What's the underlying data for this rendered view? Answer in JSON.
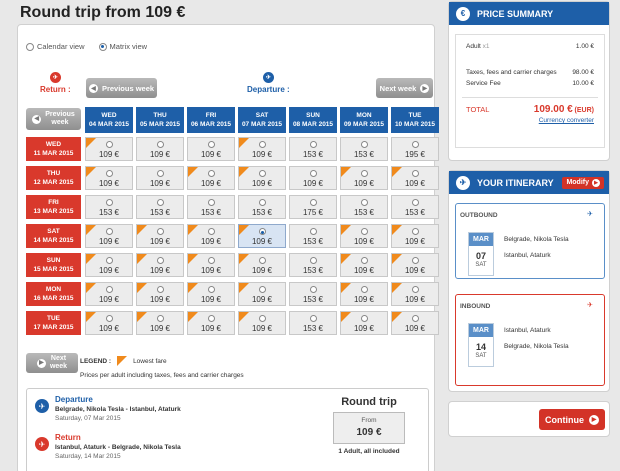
{
  "page_title": "Round trip from 109 €",
  "view_options": {
    "calendar": "Calendar view",
    "matrix": "Matrix view"
  },
  "return_label": "Return :",
  "departure_label": "Departure :",
  "prev_week": "Previous week",
  "next_week": "Next week",
  "prev_week_col": [
    "Previous",
    "week"
  ],
  "next_week_row": [
    "Next",
    "week"
  ],
  "columns": [
    {
      "day": "WED",
      "date": "04 MAR 2015"
    },
    {
      "day": "THU",
      "date": "05 MAR 2015"
    },
    {
      "day": "FRI",
      "date": "06 MAR 2015"
    },
    {
      "day": "SAT",
      "date": "07 MAR 2015"
    },
    {
      "day": "SUN",
      "date": "08 MAR 2015"
    },
    {
      "day": "MON",
      "date": "09 MAR 2015"
    },
    {
      "day": "TUE",
      "date": "10 MAR 2015"
    }
  ],
  "rows": [
    {
      "day": "WED",
      "date": "11 MAR 2015",
      "prices": [
        "109 €",
        "109 €",
        "109 €",
        "109 €",
        "153 €",
        "153 €",
        "195 €"
      ],
      "lowest": [
        true,
        false,
        false,
        true,
        false,
        false,
        false
      ]
    },
    {
      "day": "THU",
      "date": "12 MAR 2015",
      "prices": [
        "109 €",
        "109 €",
        "109 €",
        "109 €",
        "109 €",
        "109 €",
        "109 €"
      ],
      "lowest": [
        true,
        false,
        true,
        true,
        false,
        true,
        true
      ]
    },
    {
      "day": "FRI",
      "date": "13 MAR 2015",
      "prices": [
        "153 €",
        "153 €",
        "153 €",
        "153 €",
        "175 €",
        "153 €",
        "153 €"
      ],
      "lowest": [
        false,
        false,
        false,
        false,
        false,
        false,
        false
      ]
    },
    {
      "day": "SAT",
      "date": "14 MAR 2015",
      "prices": [
        "109 €",
        "109 €",
        "109 €",
        "109 €",
        "153 €",
        "109 €",
        "109 €"
      ],
      "lowest": [
        true,
        true,
        true,
        true,
        false,
        true,
        true
      ]
    },
    {
      "day": "SUN",
      "date": "15 MAR 2015",
      "prices": [
        "109 €",
        "109 €",
        "109 €",
        "109 €",
        "153 €",
        "109 €",
        "109 €"
      ],
      "lowest": [
        true,
        true,
        true,
        true,
        false,
        true,
        true
      ]
    },
    {
      "day": "MON",
      "date": "16 MAR 2015",
      "prices": [
        "109 €",
        "109 €",
        "109 €",
        "109 €",
        "153 €",
        "109 €",
        "109 €"
      ],
      "lowest": [
        true,
        true,
        true,
        true,
        false,
        true,
        true
      ]
    },
    {
      "day": "TUE",
      "date": "17 MAR 2015",
      "prices": [
        "109 €",
        "109 €",
        "109 €",
        "109 €",
        "153 €",
        "109 €",
        "109 €"
      ],
      "lowest": [
        true,
        true,
        true,
        true,
        false,
        true,
        true
      ]
    }
  ],
  "selected_cell": {
    "row": 3,
    "col": 3
  },
  "legend": {
    "title": "LEGEND :",
    "lowest": "Lowest fare",
    "note": "Prices per adult including taxes, fees and carrier charges"
  },
  "summary": {
    "departure": {
      "title": "Departure",
      "route": "Belgrade, Nikola Tesla - Istanbul, Ataturk",
      "date": "Saturday, 07 Mar 2015"
    },
    "return": {
      "title": "Return",
      "route": "Istanbul, Ataturk - Belgrade, Nikola Tesla",
      "date": "Saturday, 14 Mar 2015"
    },
    "round_trip": "Round trip",
    "from": "From",
    "price": "109 €",
    "note": "1 Adult, all included"
  },
  "price_summary": {
    "title": "PRICE SUMMARY",
    "adult_label": "Adult",
    "adult_count": "x1",
    "adult_value": "1.00 €",
    "taxes_label": "Taxes, fees and carrier charges",
    "taxes_value": "98.00 €",
    "fee_label": "Service Fee",
    "fee_value": "10.00 €",
    "total_label": "TOTAL",
    "total_value": "109.00 €",
    "total_currency": "(EUR)",
    "converter": "Currency converter"
  },
  "itinerary": {
    "title": "YOUR ITINERARY",
    "modify": "Modify",
    "outbound": {
      "label": "OUTBOUND",
      "month": "MAR",
      "day": "07",
      "weekday": "SAT",
      "from": "Belgrade, Nikola Tesla",
      "to": "Istanbul, Ataturk"
    },
    "inbound": {
      "label": "INBOUND",
      "month": "MAR",
      "day": "14",
      "weekday": "SAT",
      "from": "Istanbul, Ataturk",
      "to": "Belgrade, Nikola Tesla"
    }
  },
  "continue": "Continue",
  "colors": {
    "blue": "#1e5fa8",
    "red": "#d9392c",
    "orange": "#f08a1c"
  }
}
